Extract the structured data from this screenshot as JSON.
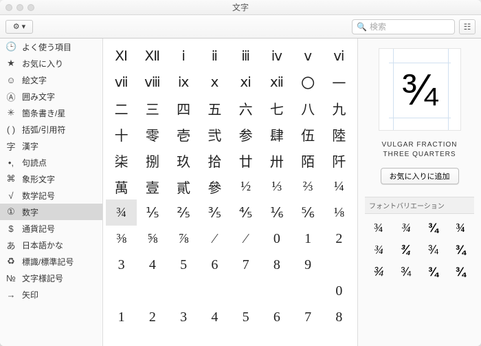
{
  "window": {
    "title": "文字"
  },
  "toolbar": {
    "search_placeholder": "検索"
  },
  "sidebar": {
    "items": [
      {
        "icon": "🕒",
        "label": "よく使う項目"
      },
      {
        "icon": "★",
        "label": "お気に入り"
      },
      {
        "icon": "☺",
        "label": "絵文字"
      },
      {
        "icon": "Ⓐ",
        "label": "囲み文字"
      },
      {
        "icon": "✳",
        "label": "箇条書き/星"
      },
      {
        "icon": "( )",
        "label": "括弧/引用符"
      },
      {
        "icon": "字",
        "label": "漢字"
      },
      {
        "icon": "•,",
        "label": "句読点"
      },
      {
        "icon": "⌘",
        "label": "象形文字"
      },
      {
        "icon": "√",
        "label": "数学記号"
      },
      {
        "icon": "①",
        "label": "数字"
      },
      {
        "icon": "$",
        "label": "通貨記号"
      },
      {
        "icon": "あ",
        "label": "日本語かな"
      },
      {
        "icon": "♻",
        "label": "標識/標準記号"
      },
      {
        "icon": "№",
        "label": "文字様記号"
      },
      {
        "icon": "→",
        "label": "矢印"
      }
    ],
    "selected_index": 10
  },
  "grid": {
    "cells": [
      "Ⅺ",
      "Ⅻ",
      "ⅰ",
      "ⅱ",
      "ⅲ",
      "ⅳ",
      "ⅴ",
      "ⅵ",
      "ⅶ",
      "ⅷ",
      "ⅸ",
      "ⅹ",
      "ⅺ",
      "ⅻ",
      "〇",
      "一",
      "二",
      "三",
      "四",
      "五",
      "六",
      "七",
      "八",
      "九",
      "十",
      "零",
      "壱",
      "弐",
      "参",
      "肆",
      "伍",
      "陸",
      "柒",
      "捌",
      "玖",
      "拾",
      "廿",
      "卅",
      "陌",
      "阡",
      "萬",
      "壹",
      "貳",
      "參",
      "½",
      "⅓",
      "⅔",
      "¼",
      "¾",
      "⅕",
      "⅖",
      "⅗",
      "⅘",
      "⅙",
      "⅚",
      "⅛",
      "⅜",
      "⅝",
      "⅞",
      "⁄",
      "⁄",
      "0",
      "1",
      "2",
      "3",
      "4",
      "5",
      "6",
      "7",
      "8",
      "9",
      "",
      "",
      "",
      "",
      "",
      "",
      "",
      "",
      "0",
      "1",
      "2",
      "3",
      "4",
      "5",
      "6",
      "7",
      "8"
    ],
    "selected_index": 48
  },
  "detail": {
    "glyph": "¾",
    "name_line1": "VULGAR FRACTION",
    "name_line2": "THREE QUARTERS",
    "favorite_button": "お気に入りに追加",
    "variations_label": "フォントバリエーション",
    "variations": [
      "¾",
      "¾",
      "¾",
      "¾",
      "¾",
      "¾",
      "¾",
      "¾",
      "¾",
      "¾",
      "¾",
      "¾"
    ]
  }
}
